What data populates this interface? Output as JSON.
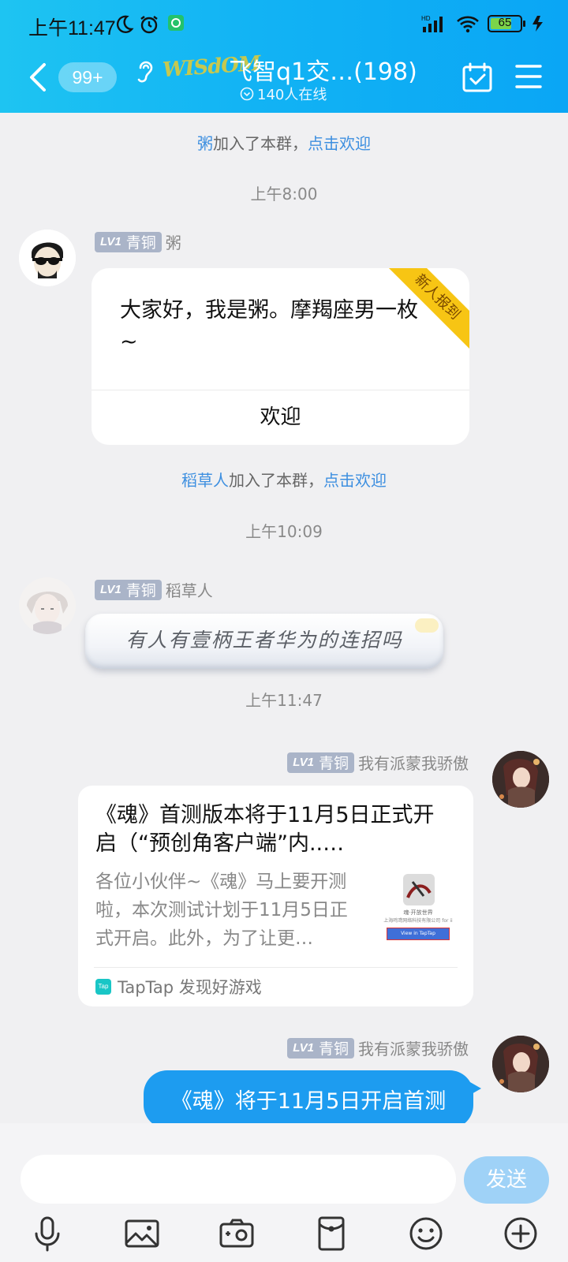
{
  "status_bar": {
    "time": "上午11:47",
    "battery": "65",
    "network": "HD"
  },
  "header": {
    "unread_count": "99+",
    "group_logo_text": "WISdOM",
    "group_title": "飞智q1交…(198)",
    "online_text": "140人在线"
  },
  "messages": {
    "sys1": {
      "name": "粥",
      "text": "加入了本群，",
      "action": "点击欢迎"
    },
    "time1": "上午8:00",
    "msg1": {
      "level_badge": "LV1",
      "level_name": "青铜",
      "sender": "粥",
      "ribbon": "新人报到",
      "text": "大家好，我是粥。摩羯座男一枚~",
      "action": "欢迎"
    },
    "sys2": {
      "name": "稻草人",
      "text": "加入了本群，",
      "action": "点击欢迎"
    },
    "time2": "上午10:09",
    "msg2": {
      "level_badge": "LV1",
      "level_name": "青铜",
      "sender": "稻草人",
      "text": "有人有壹柄王者华为的连招吗"
    },
    "time3": "上午11:47",
    "msg3": {
      "level_badge": "LV1",
      "level_name": "青铜",
      "sender": "我有派蒙我骄傲",
      "title": "《魂》首测版本将于11月5日正式开启（“预创角客户端”内..…",
      "desc": "各位小伙伴~《魂》马上要开测啦，本次测试计划于11月5日正式开启。此外，为了让更…",
      "thumb_caption": "魂·开放世界",
      "thumb_sub": "上海鸣鸢网络科技有限公司 for ii",
      "thumb_button": "View in TapTap",
      "source_icon": "Tap",
      "source": "TapTap 发现好游戏"
    },
    "msg4": {
      "level_badge": "LV1",
      "level_name": "青铜",
      "sender": "我有派蒙我骄傲",
      "text": "《魂》将于11月5日开启首测"
    }
  },
  "composer": {
    "placeholder": "",
    "send_label": "发送"
  },
  "toolbar": {
    "items": [
      "mic-icon",
      "image-icon",
      "camera-icon",
      "red-packet-icon",
      "emoji-icon",
      "plus-icon"
    ]
  },
  "colors": {
    "header": "#12b3f4",
    "accent": "#1d9cf0",
    "link": "#3d8fe0",
    "ribbon": "#f7c514"
  }
}
